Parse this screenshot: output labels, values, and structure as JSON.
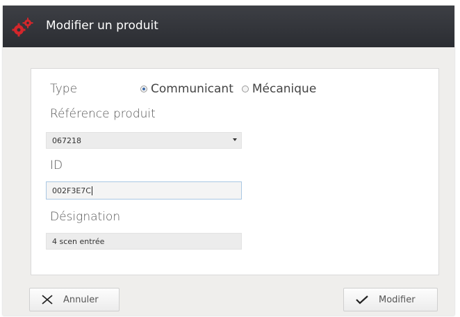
{
  "window": {
    "title": "Modifier un produit",
    "title_icon": "gears-icon"
  },
  "form": {
    "type_label": "Type",
    "type_options": [
      {
        "label": "Communicant",
        "checked": true
      },
      {
        "label": "Mécanique",
        "checked": false
      }
    ],
    "reference_label": "Référence produit",
    "reference_value": "067218",
    "id_label": "ID",
    "id_value": "002F3E7C",
    "designation_label": "Désignation",
    "designation_value": "4 scen entrée"
  },
  "buttons": {
    "cancel_label": "Annuler",
    "cancel_icon": "close-icon",
    "submit_label": "Modifier",
    "submit_icon": "checkmark-icon"
  },
  "colors": {
    "titlebar": "#2f3136",
    "gear_icon": "#d4262b",
    "radio_selected": "#3b6aa8"
  }
}
